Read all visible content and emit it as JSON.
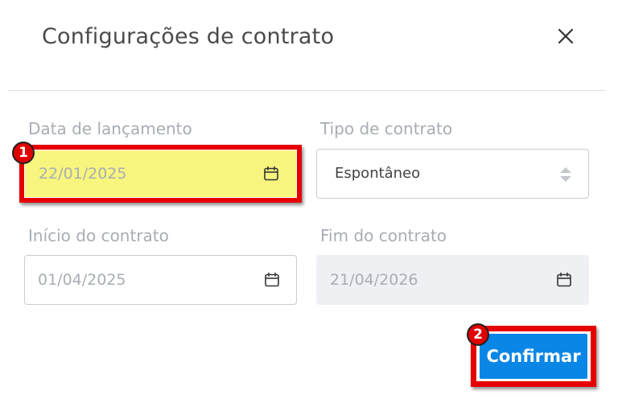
{
  "modal": {
    "title": "Configurações de contrato",
    "close_icon": "close-icon"
  },
  "fields": {
    "release_date": {
      "label": "Data de lançamento",
      "value": "22/01/2025",
      "icon": "calendar-icon"
    },
    "contract_type": {
      "label": "Tipo de contrato",
      "value": "Espontâneo",
      "icon": "sort-arrows-icon"
    },
    "contract_start": {
      "label": "Início do contrato",
      "value": "01/04/2025",
      "icon": "calendar-icon"
    },
    "contract_end": {
      "label": "Fim do contrato",
      "value": "21/04/2026",
      "icon": "calendar-icon",
      "disabled": true
    }
  },
  "actions": {
    "confirm_label": "Confirmar"
  },
  "annotations": {
    "step1": "1",
    "step2": "2"
  },
  "colors": {
    "primary": "#0a86e6",
    "highlight_border": "#e60000",
    "highlight_fill": "#f7f57e",
    "muted_text": "#a8adb4"
  }
}
